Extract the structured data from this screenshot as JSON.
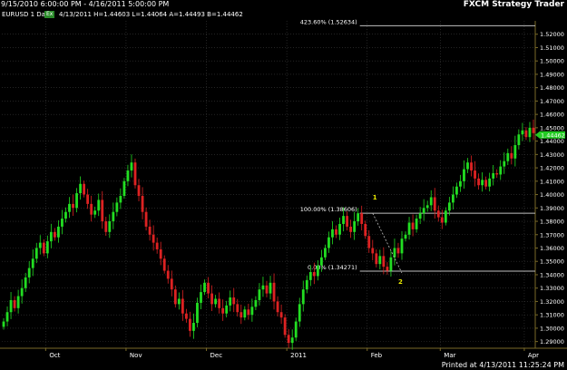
{
  "window": {
    "date_range": "9/15/2010 6:00:00 PM - 4/16/2011 5:00:00 PM",
    "brand": "FXCM Strategy Trader"
  },
  "info": {
    "symbol": "EURUSD",
    "timeframe": "1 Day",
    "tag": "Ex",
    "ohlc": "4/13/2011  H=1.44603  L=1.44064  A=1.44493  B=1.44462"
  },
  "footer": {
    "printed": "Printed at 4/13/2011 11:25:24 PM"
  },
  "colors": {
    "up": "#22dd22",
    "down": "#dd2222",
    "grid": "#3a3a3a",
    "axis": "#7a6a28",
    "fib": "#bfbfbf",
    "marker": "#e8e800",
    "last_price": "#22cc22",
    "background": "#000000"
  },
  "chart_data": {
    "type": "candlestick",
    "ylim": [
      1.285,
      1.53
    ],
    "y_ticks": [
      "1.52000",
      "1.51000",
      "1.50000",
      "1.49000",
      "1.48000",
      "1.47000",
      "1.46000",
      "1.45000",
      "1.44000",
      "1.43000",
      "1.42000",
      "1.41000",
      "1.40000",
      "1.39000",
      "1.38000",
      "1.37000",
      "1.36000",
      "1.35000",
      "1.34000",
      "1.33000",
      "1.32000",
      "1.31000",
      "1.30000",
      "1.29000"
    ],
    "x_labels": [
      {
        "label": "Oct",
        "bar": 12
      },
      {
        "label": "Nov",
        "bar": 34
      },
      {
        "label": "Dec",
        "bar": 56
      },
      {
        "label": "2011",
        "bar": 78
      },
      {
        "label": "Feb",
        "bar": 100
      },
      {
        "label": "Mar",
        "bar": 120
      },
      {
        "label": "Apr",
        "bar": 143
      }
    ],
    "last_price": "1.44462",
    "fib_levels": [
      {
        "label": "423.60% (1.52634)",
        "price": 1.52634,
        "start_bar": 98
      },
      {
        "label": "100.00% (1.38606)",
        "price": 1.38606,
        "start_bar": 98
      },
      {
        "label": "0.00% (1.34271)",
        "price": 1.34271,
        "start_bar": 98
      }
    ],
    "fib_points": [
      {
        "label": "1",
        "bar": 101,
        "price": 1.38606
      },
      {
        "label": "2",
        "bar": 107,
        "price": 1.34271
      }
    ],
    "closes": [
      1.305,
      1.312,
      1.321,
      1.315,
      1.324,
      1.33,
      1.338,
      1.345,
      1.352,
      1.36,
      1.364,
      1.356,
      1.365,
      1.372,
      1.368,
      1.376,
      1.382,
      1.387,
      1.393,
      1.39,
      1.401,
      1.408,
      1.4,
      1.393,
      1.385,
      1.388,
      1.396,
      1.38,
      1.372,
      1.38,
      1.387,
      1.394,
      1.399,
      1.41,
      1.418,
      1.424,
      1.407,
      1.399,
      1.387,
      1.376,
      1.37,
      1.364,
      1.359,
      1.352,
      1.343,
      1.337,
      1.329,
      1.318,
      1.322,
      1.311,
      1.307,
      1.298,
      1.304,
      1.319,
      1.327,
      1.334,
      1.326,
      1.318,
      1.322,
      1.315,
      1.311,
      1.317,
      1.323,
      1.318,
      1.312,
      1.308,
      1.314,
      1.31,
      1.316,
      1.321,
      1.329,
      1.332,
      1.326,
      1.334,
      1.32,
      1.312,
      1.308,
      1.295,
      1.289,
      1.293,
      1.305,
      1.318,
      1.329,
      1.336,
      1.342,
      1.339,
      1.347,
      1.353,
      1.36,
      1.368,
      1.374,
      1.37,
      1.378,
      1.384,
      1.376,
      1.372,
      1.38,
      1.386,
      1.378,
      1.369,
      1.36,
      1.356,
      1.348,
      1.354,
      1.346,
      1.343,
      1.353,
      1.36,
      1.356,
      1.367,
      1.37,
      1.379,
      1.374,
      1.382,
      1.386,
      1.39,
      1.392,
      1.398,
      1.388,
      1.383,
      1.379,
      1.388,
      1.394,
      1.4,
      1.406,
      1.41,
      1.419,
      1.424,
      1.418,
      1.412,
      1.407,
      1.411,
      1.406,
      1.412,
      1.416,
      1.415,
      1.421,
      1.425,
      1.431,
      1.427,
      1.437,
      1.445,
      1.448,
      1.443,
      1.45,
      1.446
    ]
  }
}
